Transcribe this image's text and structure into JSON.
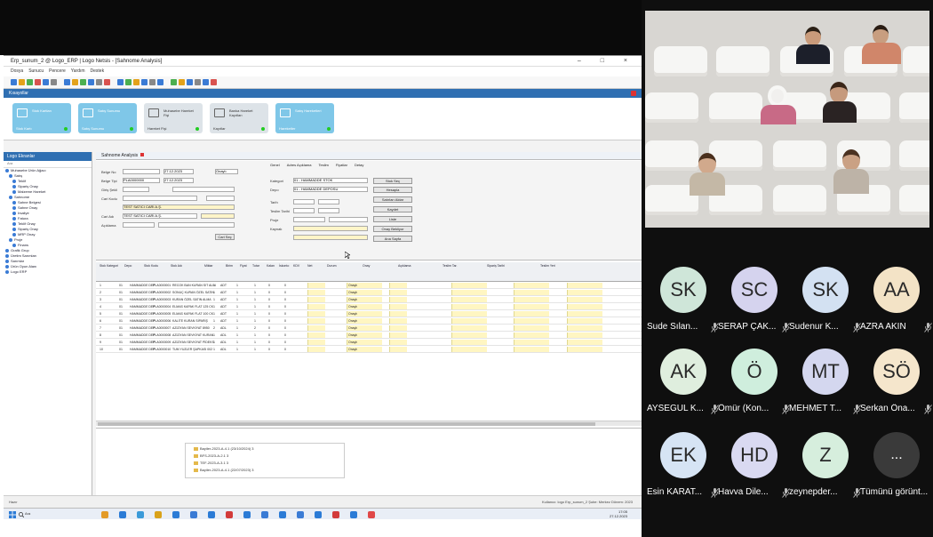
{
  "app": {
    "title": "Erp_sunum_2 @ Logo_ERP | Logo Netsis - [Sahnome Analysis]",
    "window_controls": "– □ ×",
    "menu": [
      "Dosya",
      "Sunucu",
      "Pencere",
      "Yardım",
      "Destek"
    ],
    "shortcut_title": "Kısayollar",
    "tiles": [
      {
        "name": "Stok Kartları",
        "foot": "Stok Kartı",
        "style": "blue"
      },
      {
        "name": "Satış Sunumu",
        "foot": "Satış Sunumu",
        "style": "blue"
      },
      {
        "name": "Muhasebe Hareket Fişi",
        "foot": "Hareket Fişi",
        "style": "grey"
      },
      {
        "name": "Banka Hareket Kayıtları",
        "foot": "Kayıtlar",
        "style": "grey"
      },
      {
        "name": "Satış Hareketleri",
        "foot": "Hareketler",
        "style": "blue"
      }
    ],
    "tree_title": "Logo Ekranlar",
    "tree_search": "Ara",
    "tree_items": [
      "Muhasebe Ürün Ağacı",
      "Satış",
      "Teklif",
      "Sipariş Onay",
      "Malzeme Hareket",
      "Sahnome",
      "Sahne Belgesi",
      "Sahne Onay",
      "Irsaliye",
      "Fatura",
      "Teklif Onay",
      "Sipariş Onay",
      "MRP Onay",
      "Proje",
      "Finans",
      "Grafik Grup",
      "Üretim Sarımları",
      "Sarımlar",
      "Ürün Oyun Alanı",
      "Logo ERP"
    ],
    "work_tab": "Sahnome Analysis",
    "subtabs": [
      "Genel",
      "Adres Açıklama",
      "Teslim",
      "Fiyatlar",
      "Detay"
    ],
    "form_labels": [
      "Belge No",
      "Belge Tipi",
      "Giriş Şekli",
      "Cari Kodu",
      "Cari Adı",
      "Açıklama",
      "Depo",
      "Tarih",
      "Teslim Tarihi",
      "Kategori",
      "Proje",
      "Kaynak"
    ],
    "form_values": {
      "belge_no": "PLA0000000",
      "tarih1": "27.12.2023",
      "tarih2": "27.12.2023",
      "cari": "TEST SATICI CARİ A.Ş.",
      "kategori": "01 - HAMMADDE STOK",
      "depo": "01 - HAMMADDE DEPOSU",
      "onay": "Onaylı"
    },
    "form_buttons": [
      "Cari Seç",
      "Stok Seç",
      "Hesapla",
      "Satırları Aktar",
      "Kaydet",
      "Liste",
      "Onay Bekliyor",
      "Ana Sayfa"
    ],
    "grid_headers": [
      "Stok Kategori",
      "Depo",
      "Stok Kodu",
      "Stok Adı",
      "Miktar",
      "Birim",
      "Fiyat",
      "Tutar",
      "Kalan",
      "İskonto",
      "KDV",
      "Net",
      "Durum",
      "Onay",
      "Açıklama",
      "Teslim Tar.",
      "Sipariş Tarihi",
      "Teslim Yeri"
    ],
    "grid_rows": [
      {
        "no": "1",
        "cat": "01",
        "dep": "HAMMADDE DEP",
        "code": "PLA0000001",
        "name": "RECOK BAN KURAN SIT ALIN",
        "qty": "1",
        "unit": "ADT",
        "n1": "1",
        "n2": "1",
        "n3": "0",
        "n4": "0",
        "status": "Onaylı"
      },
      {
        "no": "2",
        "cat": "01",
        "dep": "HAMMADDE DEP",
        "code": "PLA0000002",
        "name": "SONUÇ KURAN ÖZEL SATIN",
        "qty": "1",
        "unit": "ADT",
        "n1": "1",
        "n2": "1",
        "n3": "0",
        "n4": "0",
        "status": "Onaylı"
      },
      {
        "no": "3",
        "cat": "01",
        "dep": "HAMMADDE DEP",
        "code": "PLA0000003",
        "name": "KURAN ÖZEL SATIN ALMA",
        "qty": "1",
        "unit": "ADT",
        "n1": "1",
        "n2": "1",
        "n3": "0",
        "n4": "0",
        "status": "Onaylı"
      },
      {
        "no": "4",
        "cat": "01",
        "dep": "HAMMADDE DEP",
        "code": "PLA0000004",
        "name": "ELMAS KAPAK FLAT 125 CK",
        "qty": "1",
        "unit": "ADT",
        "n1": "1",
        "n2": "1",
        "n3": "0",
        "n4": "0",
        "status": "Onaylı"
      },
      {
        "no": "5",
        "cat": "01",
        "dep": "HAMMADDE DEP",
        "code": "PLA0000005",
        "name": "ELMAS KAPAK FLAT 100 CK",
        "qty": "1",
        "unit": "ADT",
        "n1": "1",
        "n2": "1",
        "n3": "0",
        "n4": "0",
        "status": "Onaylı"
      },
      {
        "no": "6",
        "cat": "01",
        "dep": "HAMMADDE DEP",
        "code": "PLA0000006",
        "name": "KALİTE KURAN SİPARİŞ",
        "qty": "1",
        "unit": "ADT",
        "n1": "1",
        "n2": "1",
        "n3": "0",
        "n4": "0",
        "status": "Onaylı"
      },
      {
        "no": "7",
        "cat": "01",
        "dep": "HAMMADDE DEP",
        "code": "PLA0000007",
        "name": "AZIZIYAN SEVKİYAT 8950",
        "qty": "2",
        "unit": "ADL",
        "n1": "1",
        "n2": "2",
        "n3": "0",
        "n4": "0",
        "status": "Onaylı"
      },
      {
        "no": "8",
        "cat": "01",
        "dep": "HAMMADDE DEP",
        "code": "PLA0000008",
        "name": "AZIZIYAN SEVKİYAT KURAN",
        "qty": "1",
        "unit": "ADL",
        "n1": "1",
        "n2": "1",
        "n3": "0",
        "n4": "0",
        "status": "Onaylı"
      },
      {
        "no": "9",
        "cat": "01",
        "dep": "HAMMADDE DEP",
        "code": "PLA0000009",
        "name": "AZIZIYAN SEVKİYAT PİDEKS",
        "qty": "1",
        "unit": "ADL",
        "n1": "1",
        "n2": "1",
        "n3": "0",
        "n4": "0",
        "status": "Onaylı"
      },
      {
        "no": "10",
        "cat": "01",
        "dep": "HAMMADDE DEP",
        "code": "PLA0000010",
        "name": "TUM YUZLER ŞAPKASI 002",
        "qty": "1",
        "unit": "ADL",
        "n1": "1",
        "n2": "1",
        "n3": "0",
        "n4": "0",
        "status": "Onaylı"
      }
    ],
    "attachments": [
      "Bayiler-2023-A-4.1 (23/10/2024) 3",
      "BFS-2023-A-2.1 3",
      "TEF-2023-A-3.1 3",
      "Bayiler-2023-A-4.1 (22/07/2023) 3"
    ],
    "status_left": "Hazır",
    "status_right": "Kullanıcı: logo  Erp_sunum_2  Şube: Merkez  Dönem: 2023",
    "taskbar_search": "Ara",
    "clock_time": "17:05",
    "clock_date": "27.12.2023"
  },
  "call": {
    "participants": [
      {
        "initials": "SK",
        "name": "Sude Sılan...",
        "color": "#cfe6d9"
      },
      {
        "initials": "SC",
        "name": "SERAP ÇAK...",
        "color": "#d5d3ee"
      },
      {
        "initials": "SK",
        "name": "Sudenur K...",
        "color": "#d3e1f2"
      },
      {
        "initials": "AA",
        "name": "AZRA AKIN",
        "color": "#f3e3c6"
      },
      {
        "initials": "AK",
        "name": "AYSEGUL K...",
        "color": "#dfeede"
      },
      {
        "initials": "Ö",
        "name": "Ömür (Kon...",
        "color": "#cfeedd"
      },
      {
        "initials": "MT",
        "name": "MEHMET T...",
        "color": "#d4d7ef"
      },
      {
        "initials": "SÖ",
        "name": "Serkan Öna...",
        "color": "#f5e6cc"
      },
      {
        "initials": "EK",
        "name": "Esin KARAT...",
        "color": "#d6e4f4"
      },
      {
        "initials": "HD",
        "name": "Havva Dile...",
        "color": "#d9d9f1"
      },
      {
        "initials": "Z",
        "name": "zeynepder...",
        "color": "#d6eedd"
      }
    ],
    "more": {
      "initials": "...",
      "name": "Tümünü görünt..."
    }
  },
  "colors": {
    "accent": "#2f6fb2",
    "tile_blue": "#7fc7e8",
    "field_yellow": "#fff6c2"
  }
}
